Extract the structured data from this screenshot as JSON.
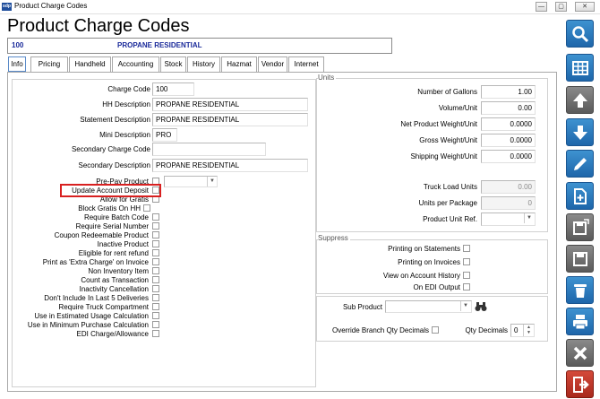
{
  "window": {
    "icon_text": "sdp",
    "title": "Product Charge Codes",
    "controls": [
      "—",
      "▢",
      "✕"
    ]
  },
  "header": {
    "title": "Product Charge Codes",
    "code": "100",
    "description": "PROPANE RESIDENTIAL"
  },
  "tabs": [
    "Info",
    "Pricing",
    "Handheld",
    "Accounting",
    "Stock",
    "History",
    "Hazmat",
    "Vendor",
    "Internet"
  ],
  "active_tab": "Info",
  "info": {
    "charge_code_label": "Charge Code",
    "charge_code": "100",
    "hh_description_label": "HH Description",
    "hh_description": "PROPANE RESIDENTIAL",
    "statement_description_label": "Statement Description",
    "statement_description": "PROPANE RESIDENTIAL",
    "mini_description_label": "Mini Description",
    "mini_description": "PRO",
    "secondary_charge_code_label": "Secondary Charge Code",
    "secondary_charge_code": "",
    "secondary_description_label": "Secondary Description",
    "secondary_description": "PROPANE RESIDENTIAL",
    "pre_pay_product_label": "Pre-Pay Product",
    "pre_pay_product_value": ""
  },
  "checkboxes": [
    "Update Account Deposit",
    "Allow for Gratis",
    "Block Gratis On HH",
    "Require Batch Code",
    "Require Serial Number",
    "Coupon Redeemable Product",
    "Inactive Product",
    "Eligible for rent refund",
    "Print as 'Extra Charge' on Invoice",
    "Non Inventory Item",
    "Count as Transaction",
    "Inactivity Cancellation",
    "Don't Include In Last 5 Deliveries",
    "Require Truck Compartment",
    "Use in Estimated Usage Calculation",
    "Use in Minimum Purchase Calculation",
    "EDI Charge/Allowance"
  ],
  "units": {
    "section_label": "Units",
    "number_of_gallons_label": "Number of Gallons",
    "number_of_gallons": "1.00",
    "volume_unit_label": "Volume/Unit",
    "volume_unit": "0.00",
    "net_weight_label": "Net Product Weight/Unit",
    "net_weight": "0.0000",
    "gross_weight_label": "Gross Weight/Unit",
    "gross_weight": "0.0000",
    "shipping_weight_label": "Shipping Weight/Unit",
    "shipping_weight": "0.0000",
    "truck_load_units_label": "Truck Load Units",
    "truck_load_units": "0.00",
    "units_per_package_label": "Units per Package",
    "units_per_package": "0",
    "product_unit_ref_label": "Product Unit Ref.",
    "product_unit_ref": ""
  },
  "suppress": {
    "section_label": "Suppress",
    "printing_statements_label": "Printing on Statements",
    "printing_invoices_label": "Printing on Invoices",
    "view_account_history_label": "View on Account History",
    "edi_output_label": "On EDI Output"
  },
  "sub": {
    "sub_product_label": "Sub Product",
    "sub_product": "",
    "override_branch_qty_label": "Override Branch Qty Decimals",
    "qty_decimals_label": "Qty Decimals",
    "qty_decimals": "0"
  },
  "toolbar": [
    "search-icon",
    "grid-icon",
    "arrow-up-icon",
    "arrow-down-icon",
    "pencil-icon",
    "new-document-icon",
    "copy-save-icon",
    "save-icon",
    "trash-icon",
    "print-icon",
    "close-icon",
    "exit-icon"
  ],
  "colors": {
    "accent": "#2a7bc4",
    "highlight": "#d82020",
    "header_text": "#1a2a9a"
  }
}
